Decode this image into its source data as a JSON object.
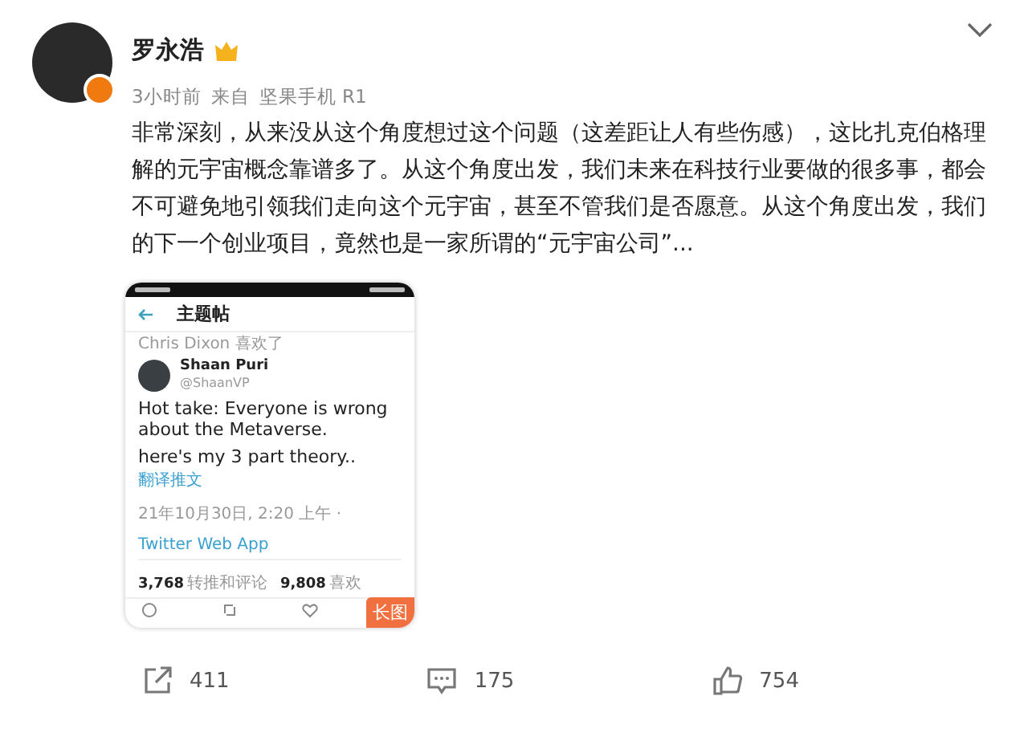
{
  "post": {
    "author": "罗永浩",
    "meta": [
      "3小时前",
      "来自",
      "坚果手机 R1"
    ],
    "body": "非常深刻，从来没从这个角度想过这个问题（这差距让人有些伤感），这比扎克伯格理解的元宇宙概念靠谱多了。从这个角度出发，我们未来在科技行业要做的很多事，都会不可避免地引领我们走向这个元宇宙，甚至不管我们是否愿意。从这个角度出发，我们的下一个创业项目，竟然也是一家所谓的“元宇宙公司”..."
  },
  "embedded_screenshot": {
    "header_title": "主题帖",
    "liked_by": "Chris Dixon 喜欢了",
    "tweet_author": "Shaan Puri",
    "tweet_handle": "@ShaanVP",
    "tweet_lines": [
      "Hot take: Everyone is wrong about the Metaverse.",
      "here's my 3 part theory.."
    ],
    "translate_link": "翻译推文",
    "timestamp": "21年10月30日, 2:20 上午 · ",
    "source_link": "Twitter Web App",
    "stats": [
      {
        "count": "3,768",
        "label": "转推和评论"
      },
      {
        "count": "9,808",
        "label": "喜欢"
      }
    ],
    "badge": "长图"
  },
  "actions": [
    {
      "kind": "repost",
      "count": "411"
    },
    {
      "kind": "comment",
      "count": "175"
    },
    {
      "kind": "like",
      "count": "754"
    }
  ]
}
